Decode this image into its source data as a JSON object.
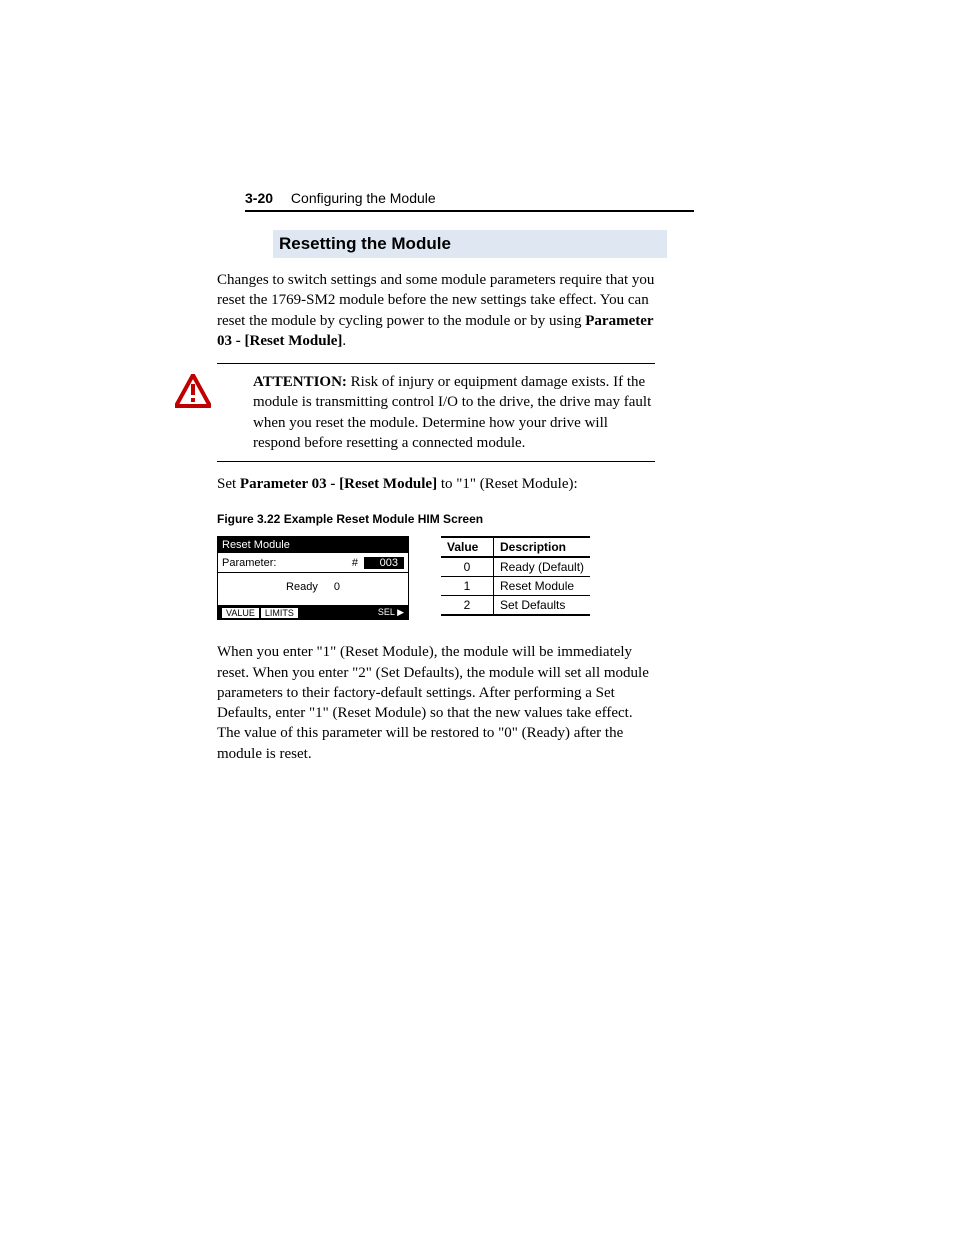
{
  "header": {
    "page_number": "3-20",
    "chapter_title": "Configuring the Module"
  },
  "section": {
    "heading": "Resetting the Module",
    "intro_part1": "Changes to switch settings and some module parameters require that you reset the 1769-SM2 module before the new settings take effect. You can reset the module by cycling power to the module or by using ",
    "intro_bold": "Parameter 03 - [Reset Module]",
    "intro_end": ".",
    "attention_label": "ATTENTION:",
    "attention_text": "  Risk of injury or equipment damage exists. If the module is transmitting control I/O to the drive, the drive may fault when you reset the module. Determine how your drive will respond before resetting a connected module.",
    "set_line_pre": "Set ",
    "set_line_bold": "Parameter 03 - [Reset Module]",
    "set_line_post": " to \"1\" (Reset Module):",
    "figure_caption": "Figure 3.22    Example Reset Module HIM Screen",
    "closing_para": "When you enter \"1\" (Reset Module), the module will be immediately reset. When you enter \"2\" (Set Defaults), the module will set all module parameters to their factory-default settings. After performing a Set Defaults, enter \"1\" (Reset Module) so that the new values take effect. The value of this parameter will be restored to \"0\" (Ready) after the module is reset."
  },
  "him": {
    "title": "Reset Module",
    "param_label": "Parameter:",
    "hash": "#",
    "param_num": "003",
    "status": "Ready",
    "status_val": "0",
    "tab_value": "VALUE",
    "tab_limits": "LIMITS",
    "sel": "SEL"
  },
  "table": {
    "col_value": "Value",
    "col_desc": "Description",
    "rows": [
      {
        "v": "0",
        "d": "Ready (Default)"
      },
      {
        "v": "1",
        "d": "Reset Module"
      },
      {
        "v": "2",
        "d": "Set Defaults"
      }
    ]
  }
}
